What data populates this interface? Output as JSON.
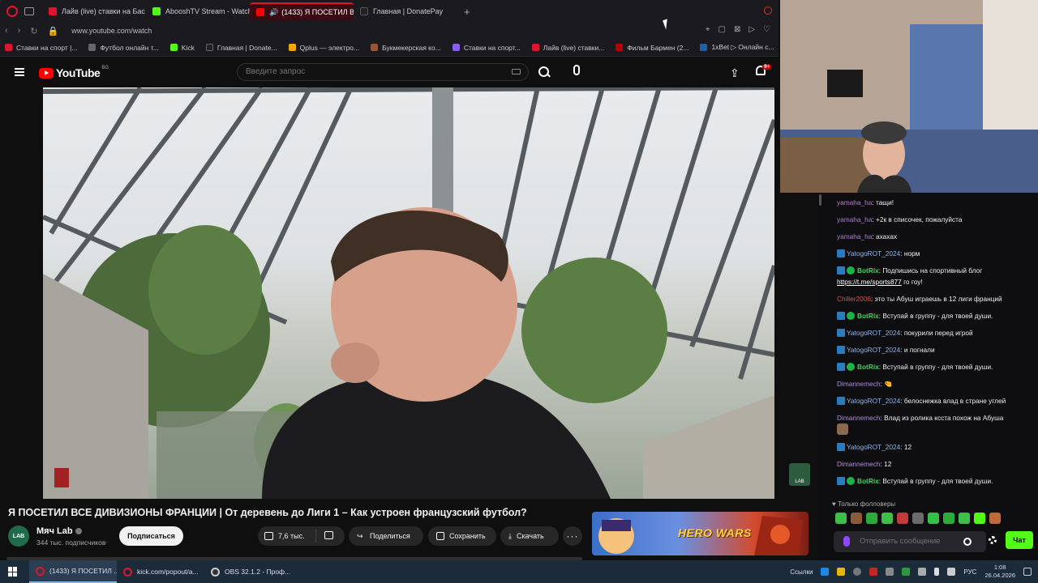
{
  "browser": {
    "tabs": [
      {
        "label": "Лайв (live) ставки на Бас",
        "color": "#e0152d"
      },
      {
        "label": "AbooshTV Stream - Watch",
        "color": "#53fc18"
      },
      {
        "label": "(1433) Я ПОСЕТИЛ ВС",
        "color": "#ff0000"
      },
      {
        "label": "Главная | DonatePay",
        "color": "#222"
      }
    ],
    "new_tab_symbol": "+",
    "url": "www.youtube.com/watch",
    "bookmarks": [
      {
        "label": "Ставки на спорт |...",
        "color": "#e0152d"
      },
      {
        "label": "Футбол онлайн т...",
        "color": "#666"
      },
      {
        "label": "Kick",
        "color": "#53fc18"
      },
      {
        "label": "Главная | Donate...",
        "color": "#222"
      },
      {
        "label": "Qplus — электро...",
        "color": "#f6a500"
      },
      {
        "label": "Букмекерская ко...",
        "color": "#a0522d"
      },
      {
        "label": "Ставки на спорт...",
        "color": "#8b5cf6"
      },
      {
        "label": "Лайв (live) ставки...",
        "color": "#e0152d"
      },
      {
        "label": "Фильм Бармен (2...",
        "color": "#b00"
      },
      {
        "label": "1xBet ▷ Онлайн с...",
        "color": "#1f5fa8"
      }
    ]
  },
  "youtube": {
    "logo_text": "YouTube",
    "region": "BG",
    "search_placeholder": "Введите запрос",
    "notifications_count": "9+",
    "video": {
      "title": "Я ПОСЕТИЛ ВСЕ ДИВИЗИОНЫ ФРАНЦИИ | От деревень до Лиги 1 – Как устроен французский футбол?",
      "channel": "Мяч Lab",
      "subscribers": "344 тыс. подписчиков",
      "subscribe_label": "Подписаться",
      "likes": "7,6 тыс.",
      "share_label": "Поделиться",
      "save_label": "Сохранить",
      "download_label": "Скачать",
      "more_label": "···",
      "watermark": "LAB",
      "avatar_text": "LAB"
    },
    "ad_banner": "HERO WARS"
  },
  "chat": {
    "messages": [
      {
        "user": "yamaha_ha",
        "style": "yamaha",
        "text": ": тащи!"
      },
      {
        "user": "yamaha_ha",
        "style": "yamaha",
        "text": ": +2к в списочек, пожалуйста"
      },
      {
        "user": "yamaha_ha",
        "style": "yamaha",
        "text": ": ахахах"
      },
      {
        "user": "YatogoROT_2024",
        "style": "yatogo",
        "text": ": норм"
      },
      {
        "user": "BotRix",
        "style": "botrix",
        "text": ": Подпишись на спортивный блог",
        "link": "https://t.me/sports877",
        "after": " го гоу!"
      },
      {
        "user": "Chiller2006",
        "style": "chiller",
        "text": ": это ты Абуш играешь в 12 лиги франций"
      },
      {
        "user": "BotRix",
        "style": "botrix",
        "text": ": Вступай в группу - для твоей души."
      },
      {
        "user": "YatogoROT_2024",
        "style": "yatogo",
        "text": ": покурили перед игрой"
      },
      {
        "user": "YatogoROT_2024",
        "style": "yatogo",
        "text": ": и погнали"
      },
      {
        "user": "BotRix",
        "style": "botrix",
        "text": ": Вступай в группу - для твоей души."
      },
      {
        "user": "Dimannemech",
        "style": "diman",
        "text": ": 🤏"
      },
      {
        "user": "YatogoROT_2024",
        "style": "yatogo",
        "text": ": белоснежка влад в стране углей"
      },
      {
        "user": "Dimannemech",
        "style": "diman",
        "text": ": Влад из ролика ксста похож на Абуша",
        "emote": true
      },
      {
        "user": "YatogoROT_2024",
        "style": "yatogo",
        "text": ": 12"
      },
      {
        "user": "Dimannemech",
        "style": "diman",
        "text": ": 12"
      },
      {
        "user": "BotRix",
        "style": "botrix",
        "text": ": Вступай в группу - для твоей души."
      }
    ],
    "followers_only": "♥ Только фолловеры",
    "input_placeholder": "Отправить сообщение",
    "send_label": "Чат"
  },
  "taskbar": {
    "items": [
      {
        "label": "(1433) Я ПОСЕТИЛ ...",
        "color": "#e0152d",
        "active": true
      },
      {
        "label": "kick.com/popout/a...",
        "color": "#e0152d",
        "active": false
      },
      {
        "label": "OBS 32.1.2 - Проф...",
        "color": "#333",
        "active": false
      }
    ],
    "links_label": "Ссылки",
    "lang": "РУС",
    "time": "1:08",
    "date": "26.04.2026"
  },
  "colors": {
    "yt_red": "#ff0000",
    "kick_green": "#53fc18",
    "opera_red": "#e0152d"
  }
}
